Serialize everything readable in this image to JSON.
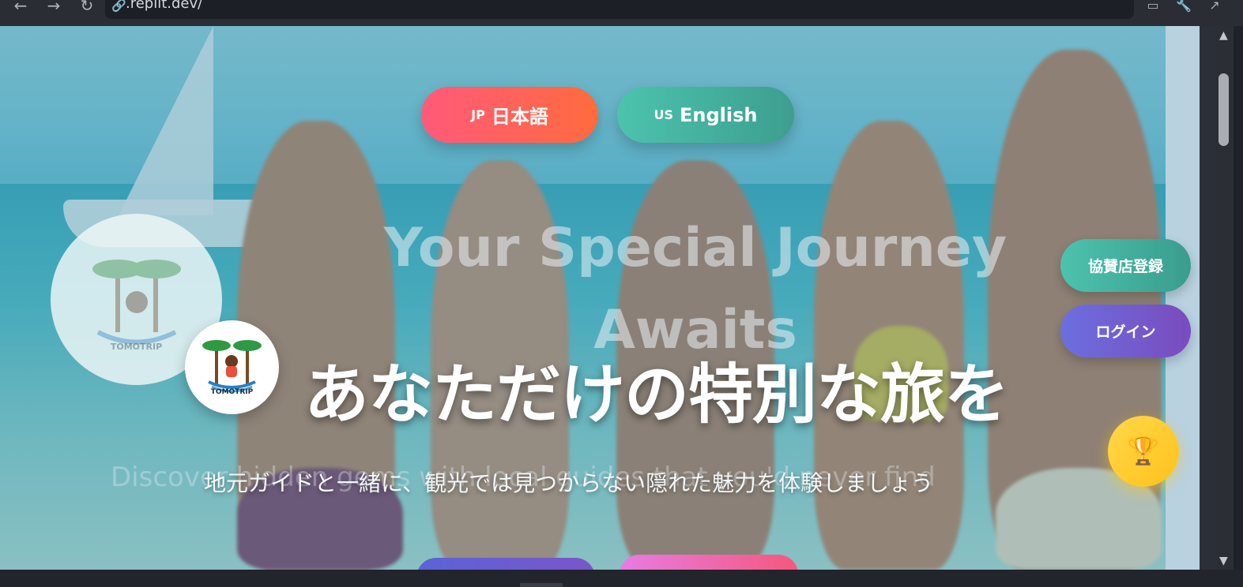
{
  "browser": {
    "url": ".replit.dev/",
    "icons": [
      "arrow-left-icon",
      "arrow-right-icon",
      "reload-icon",
      "link-icon",
      "devices-icon",
      "wrench-icon",
      "open-external-icon"
    ]
  },
  "page": {
    "lang_buttons": [
      {
        "flag": "JP",
        "label": "日本語"
      },
      {
        "flag": "US",
        "label": "English"
      }
    ],
    "background_text": {
      "title_line1": "Your Special Journey",
      "title_line2": "Awaits",
      "subtitle": "Discover hidden gems with local guides that you'd never find"
    },
    "logo": {
      "text": "TOMOTRIP",
      "faded_text": "TOMOTRIP"
    },
    "title": "あなただけの特別な旅を",
    "subtitle": "地元ガイドと一緒に、観光では見つからない隠れた魅力を体験しましょう",
    "side_buttons": {
      "sponsor": "協賛店登録",
      "login": "ログイン"
    },
    "trophy_icon": "🏆"
  },
  "colors": {
    "jp_button": "#ff5a7a",
    "en_button": "#4cc3ae",
    "login_button": "#6c6fe0",
    "trophy": "#ffd84a"
  }
}
